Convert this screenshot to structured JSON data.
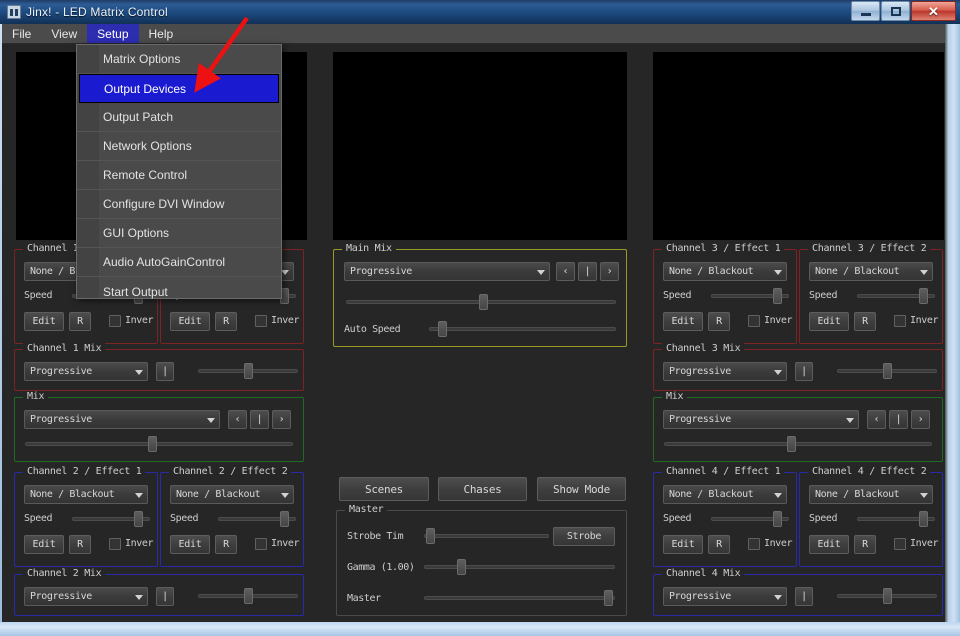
{
  "window": {
    "title": "Jinx! - LED Matrix Control",
    "icon": "app-icon",
    "buttons": {
      "minimize": "–",
      "maximize": "□",
      "close": "✕"
    }
  },
  "menubar": {
    "items": [
      {
        "label": "File",
        "active": false
      },
      {
        "label": "View",
        "active": false
      },
      {
        "label": "Setup",
        "active": true
      },
      {
        "label": "Help",
        "active": false
      }
    ]
  },
  "setup_menu": {
    "items": [
      {
        "label": "Matrix Options",
        "selected": false
      },
      {
        "label": "Output Devices",
        "selected": true
      },
      {
        "label": "Output Patch",
        "selected": false
      },
      {
        "label": "Network Options",
        "selected": false
      },
      {
        "label": "Remote Control",
        "selected": false
      },
      {
        "label": "Configure DVI Window",
        "selected": false
      },
      {
        "label": "GUI Options",
        "selected": false
      },
      {
        "label": "Audio AutoGainControl",
        "selected": false
      },
      {
        "label": "Start Output",
        "selected": false
      }
    ]
  },
  "previews": [
    {
      "name": "preview-left"
    },
    {
      "name": "preview-center"
    },
    {
      "name": "preview-right"
    }
  ],
  "common": {
    "effect_value": "None / Blackout",
    "mix_value": "Progressive",
    "speed_label": "Speed",
    "edit_label": "Edit",
    "r_label": "R",
    "invert_label": "Inver",
    "bar_label": "|",
    "prev_label": "‹",
    "next_label": "›"
  },
  "left_panel": {
    "channel1_effect1": {
      "legend": "Channel 1",
      "value": "None / B"
    },
    "channel1_effect2": {
      "legend": "",
      "value": ""
    },
    "channel1_mix": {
      "legend": "Channel 1 Mix",
      "value": "Progressive"
    },
    "mix": {
      "legend": "Mix",
      "value": "Progressive"
    },
    "channel2_effect1": {
      "legend": "Channel 2 / Effect 1",
      "value": "None / Blackout"
    },
    "channel2_effect2": {
      "legend": "Channel 2 / Effect 2",
      "value": "None / Blackout"
    },
    "channel2_mix": {
      "legend": "Channel 2 Mix",
      "value": "Progressive"
    }
  },
  "center_panel": {
    "main_mix": {
      "legend": "Main Mix",
      "value": "Progressive",
      "auto_speed_label": "Auto Speed"
    },
    "scenes": "Scenes",
    "chases": "Chases",
    "show_mode": "Show Mode",
    "master": {
      "legend": "Master",
      "strobe_time_label": "Strobe Tim",
      "strobe_button": "Strobe",
      "gamma_label": "Gamma (1.00)",
      "master_label": "Master"
    }
  },
  "right_panel": {
    "channel3_effect1": {
      "legend": "Channel 3 / Effect 1",
      "value": "None / Blackout"
    },
    "channel3_effect2": {
      "legend": "Channel 3 / Effect 2",
      "value": "None / Blackout"
    },
    "channel3_mix": {
      "legend": "Channel 3 Mix",
      "value": "Progressive"
    },
    "mix": {
      "legend": "Mix",
      "value": "Progressive"
    },
    "channel4_effect1": {
      "legend": "Channel 4 / Effect 1",
      "value": "None / Blackout"
    },
    "channel4_effect2": {
      "legend": "Channel 4 / Effect 2",
      "value": "None / Blackout"
    },
    "channel4_mix": {
      "legend": "Channel 4 Mix",
      "value": "Progressive"
    }
  },
  "colors": {
    "group_red": "#7e2323",
    "group_blue": "#2a2aa8",
    "group_green": "#1f6b22",
    "group_olive": "#9a9a25",
    "menu_highlight": "#1a1ad0",
    "annotation_arrow": "#ee1111"
  }
}
